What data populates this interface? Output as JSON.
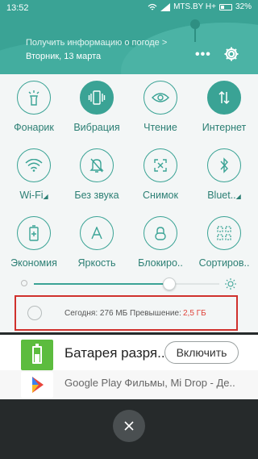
{
  "statusbar": {
    "time": "13:52",
    "carrier": "MTS.BY H+",
    "battery": "32%"
  },
  "header": {
    "weather_prompt": "Получить информацию о погоде >",
    "date": "Вторник, 13 марта",
    "more_icon": "more-dots-icon",
    "settings_icon": "gear-icon"
  },
  "toggles": [
    {
      "label": "Фонарик",
      "icon": "flashlight-icon",
      "active": false
    },
    {
      "label": "Вибрация",
      "icon": "vibration-icon",
      "active": true
    },
    {
      "label": "Чтение",
      "icon": "eye-icon",
      "active": false
    },
    {
      "label": "Интернет",
      "icon": "data-transfer-icon",
      "active": true
    },
    {
      "label": "Wi-Fi",
      "icon": "wifi-icon",
      "active": false
    },
    {
      "label": "Без звука",
      "icon": "bell-off-icon",
      "active": false
    },
    {
      "label": "Снимок",
      "icon": "screenshot-icon",
      "active": false
    },
    {
      "label": "Bluet..",
      "icon": "bluetooth-icon",
      "active": false
    },
    {
      "label": "Экономия",
      "icon": "battery-saver-icon",
      "active": false
    },
    {
      "label": "Яркость",
      "icon": "brightness-auto-icon",
      "active": false
    },
    {
      "label": "Блокиро..",
      "icon": "lock-icon",
      "active": false
    },
    {
      "label": "Сортиров..",
      "icon": "sort-grid-icon",
      "active": false
    }
  ],
  "brightness": {
    "level": 0.73
  },
  "traffic": {
    "today": "Сегодня: 276 МБ",
    "overuse_label": "Превышение:",
    "overuse_value": "2,5 ГБ"
  },
  "notifications": [
    {
      "title": "Батарея разря..",
      "action": "Включить",
      "icon": "battery-icon"
    },
    {
      "text": "Google Play Фильмы, Mi Drop - Де..",
      "icon": "google-play-icon"
    }
  ],
  "close_icon": "close-icon",
  "colors": {
    "accent": "#3aa395",
    "header": "#3aa395",
    "overuse": "#e0443b",
    "highlight_border": "#d0312d"
  }
}
